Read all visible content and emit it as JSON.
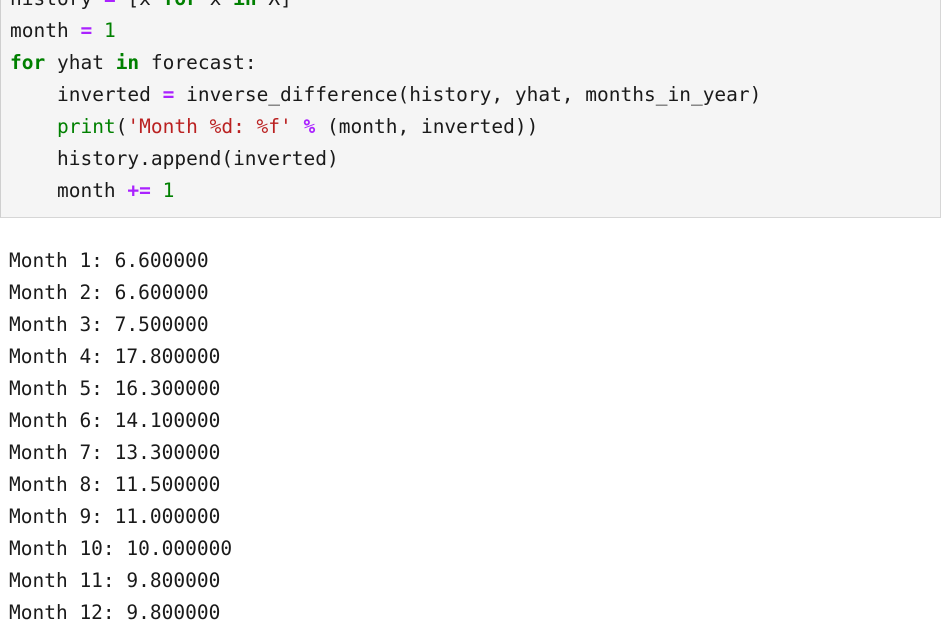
{
  "code_block": {
    "language": "python",
    "background_color": "#f5f5f5",
    "border_color": "#d6d6d6",
    "clipped_top_line": true,
    "lines": [
      {
        "indent": 0,
        "tokens": [
          {
            "t": "history",
            "c": "n"
          },
          {
            "t": " ",
            "c": "p"
          },
          {
            "t": "=",
            "c": "o"
          },
          {
            "t": " [x ",
            "c": "p"
          },
          {
            "t": "for",
            "c": "k"
          },
          {
            "t": " x ",
            "c": "p"
          },
          {
            "t": "in",
            "c": "k"
          },
          {
            "t": " X]",
            "c": "p"
          }
        ]
      },
      {
        "indent": 0,
        "tokens": [
          {
            "t": "month",
            "c": "n"
          },
          {
            "t": " ",
            "c": "p"
          },
          {
            "t": "=",
            "c": "o"
          },
          {
            "t": " ",
            "c": "p"
          },
          {
            "t": "1",
            "c": "mi"
          }
        ]
      },
      {
        "indent": 0,
        "tokens": [
          {
            "t": "for",
            "c": "k"
          },
          {
            "t": " yhat ",
            "c": "p"
          },
          {
            "t": "in",
            "c": "k"
          },
          {
            "t": " forecast:",
            "c": "p"
          }
        ]
      },
      {
        "indent": 1,
        "tokens": [
          {
            "t": "inverted",
            "c": "n"
          },
          {
            "t": " ",
            "c": "p"
          },
          {
            "t": "=",
            "c": "o"
          },
          {
            "t": " inverse_difference(history, yhat, months_in_year)",
            "c": "p"
          }
        ]
      },
      {
        "indent": 1,
        "tokens": [
          {
            "t": "print",
            "c": "nb"
          },
          {
            "t": "(",
            "c": "p"
          },
          {
            "t": "'Month %d: %f'",
            "c": "s"
          },
          {
            "t": " ",
            "c": "p"
          },
          {
            "t": "%",
            "c": "o"
          },
          {
            "t": " (month, inverted))",
            "c": "p"
          }
        ]
      },
      {
        "indent": 1,
        "tokens": [
          {
            "t": "history.append(inverted)",
            "c": "p"
          }
        ]
      },
      {
        "indent": 1,
        "tokens": [
          {
            "t": "month",
            "c": "n"
          },
          {
            "t": " ",
            "c": "p"
          },
          {
            "t": "+=",
            "c": "o"
          },
          {
            "t": " ",
            "c": "p"
          },
          {
            "t": "1",
            "c": "mi"
          }
        ]
      }
    ]
  },
  "output": {
    "background_color": "#ffffff",
    "text_color": "#1a1a1a",
    "lines": [
      "Month 1: 6.600000",
      "Month 2: 6.600000",
      "Month 3: 7.500000",
      "Month 4: 17.800000",
      "Month 5: 16.300000",
      "Month 6: 14.100000",
      "Month 7: 13.300000",
      "Month 8: 11.500000",
      "Month 9: 11.000000",
      "Month 10: 10.000000",
      "Month 11: 9.800000",
      "Month 12: 9.800000"
    ],
    "values": [
      {
        "month": 1,
        "value": 6.6
      },
      {
        "month": 2,
        "value": 6.6
      },
      {
        "month": 3,
        "value": 7.5
      },
      {
        "month": 4,
        "value": 17.8
      },
      {
        "month": 5,
        "value": 16.3
      },
      {
        "month": 6,
        "value": 14.1
      },
      {
        "month": 7,
        "value": 13.3
      },
      {
        "month": 8,
        "value": 11.5
      },
      {
        "month": 9,
        "value": 11.0
      },
      {
        "month": 10,
        "value": 10.0
      },
      {
        "month": 11,
        "value": 9.8
      },
      {
        "month": 12,
        "value": 9.8
      }
    ]
  }
}
